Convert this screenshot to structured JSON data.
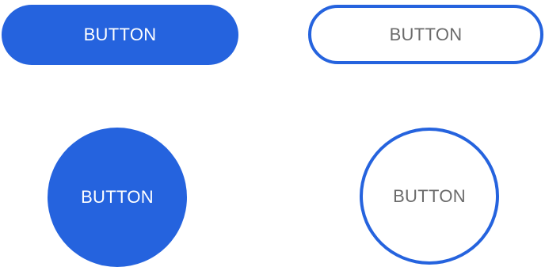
{
  "colors": {
    "primary": "#2563de",
    "filled_text": "#ffffff",
    "outlined_text": "#6b6b6b",
    "background": "#ffffff"
  },
  "buttons": {
    "pill_filled": {
      "label": "BUTTON"
    },
    "pill_outlined": {
      "label": "BUTTON"
    },
    "circle_filled": {
      "label": "BUTTON"
    },
    "circle_outlined": {
      "label": "BUTTON"
    }
  }
}
